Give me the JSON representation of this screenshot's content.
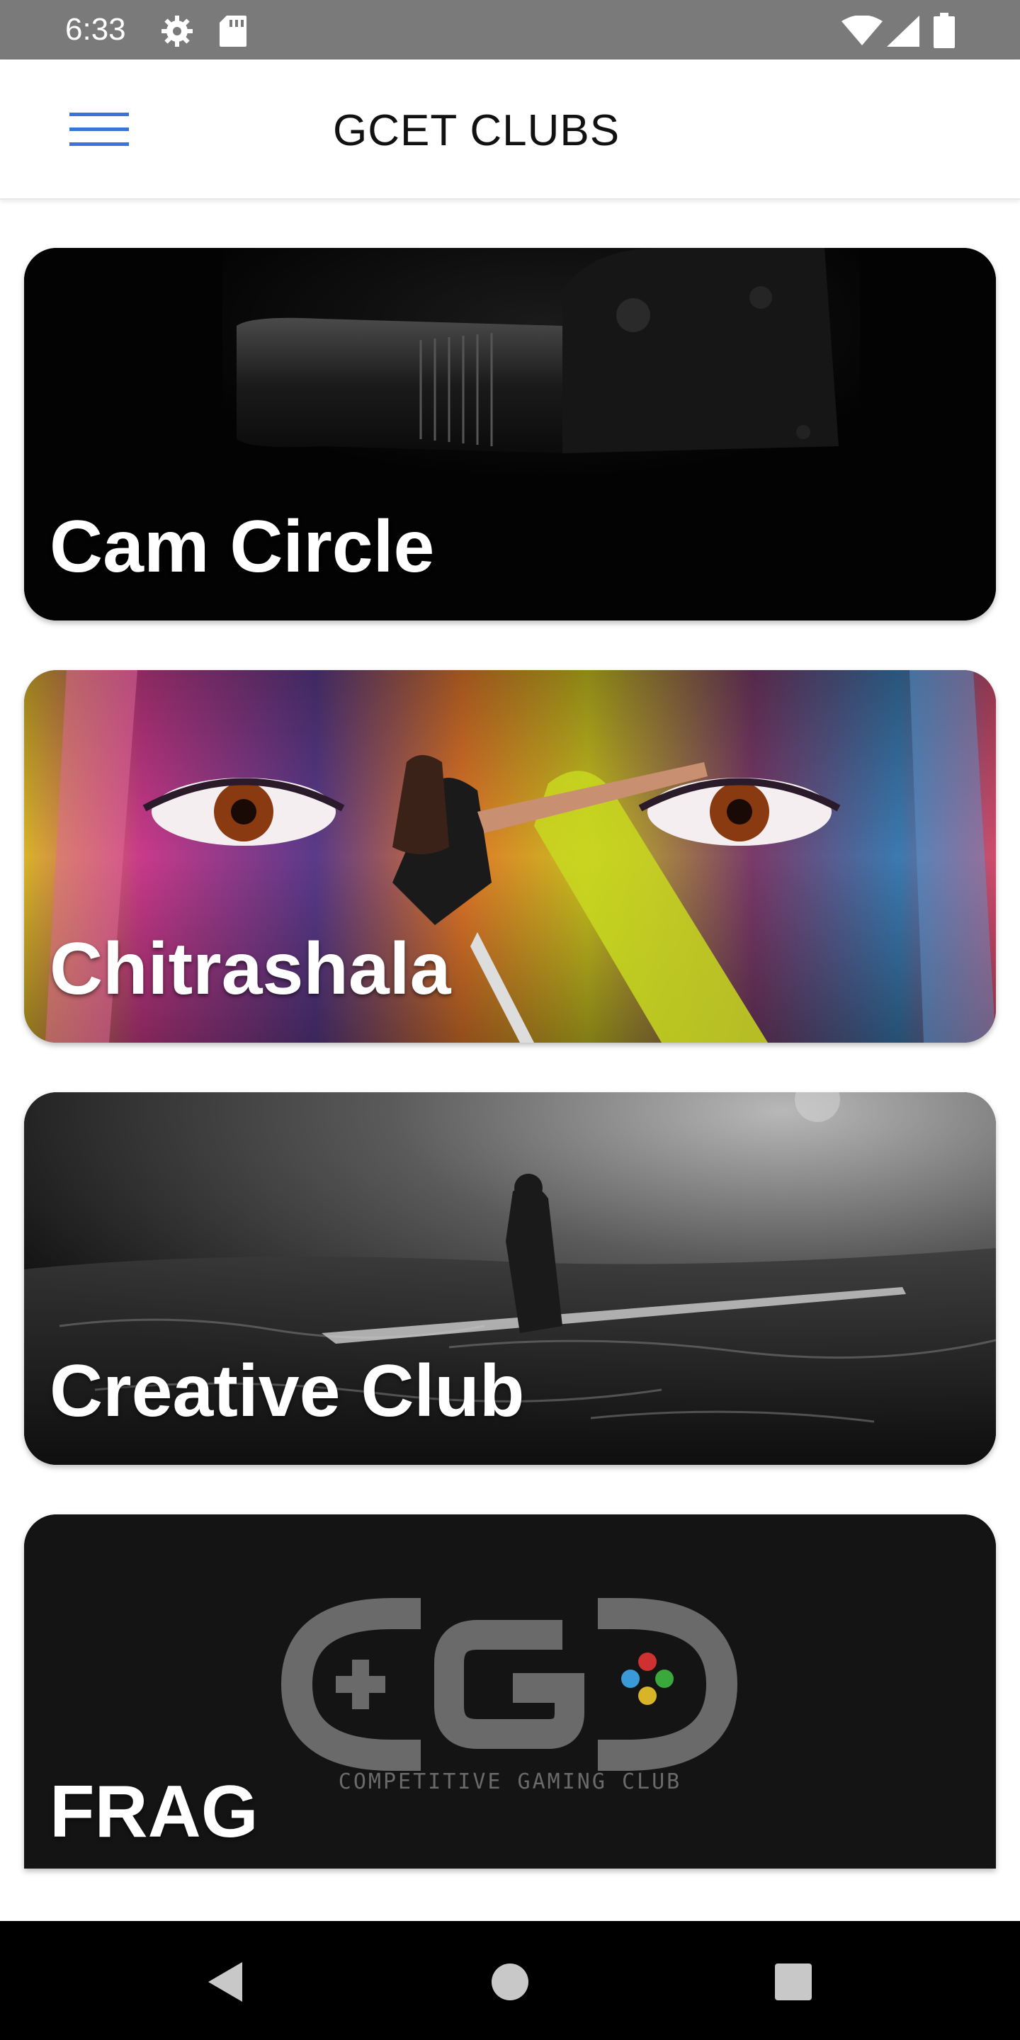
{
  "status_bar": {
    "time": "6:33",
    "icons": [
      "gear-icon",
      "sd-card-icon",
      "wifi-icon",
      "signal-icon",
      "battery-icon"
    ]
  },
  "app_bar": {
    "title": "GCET CLUBS",
    "menu_icon": "hamburger-menu-icon",
    "menu_color": "#3b74d9"
  },
  "clubs": [
    {
      "name": "Cam Circle",
      "image": "camera-lens-image"
    },
    {
      "name": "Chitrashala",
      "image": "painted-face-mural-image"
    },
    {
      "name": "Creative Club",
      "image": "foggy-sea-figure-image"
    },
    {
      "name": "FRAG",
      "image": "gaming-controller-logo-image",
      "logo_text": "COMPETITIVE GAMING CLUB"
    }
  ],
  "nav_bar": {
    "buttons": [
      "back-icon",
      "home-icon",
      "recents-icon"
    ]
  }
}
